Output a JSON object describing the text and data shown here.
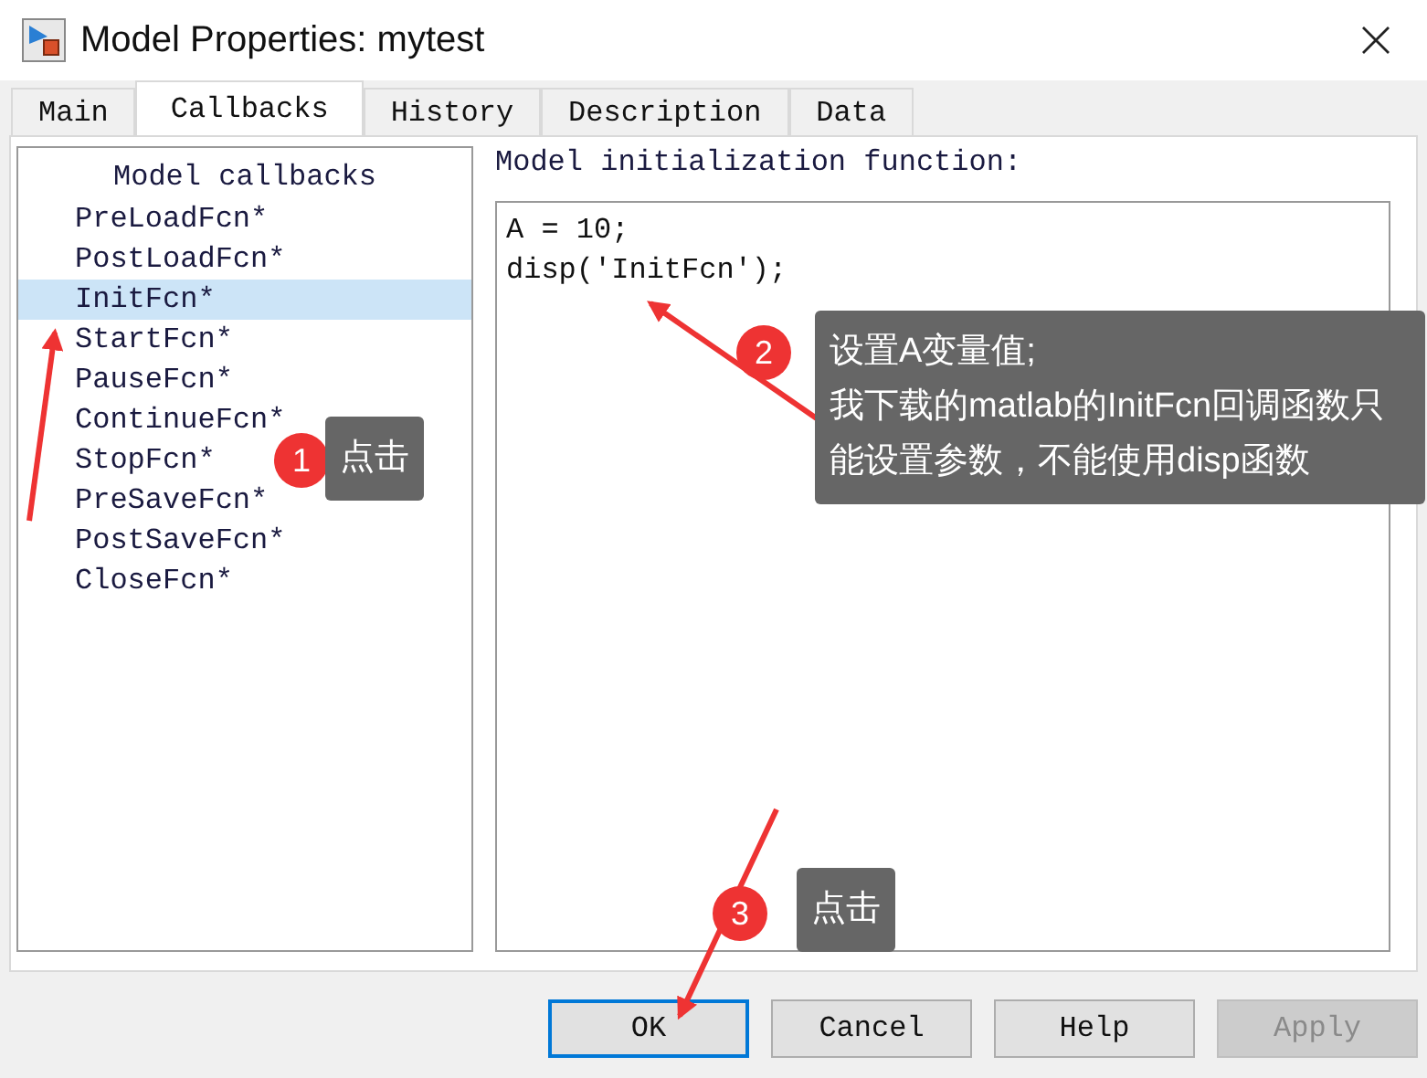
{
  "window": {
    "title": "Model Properties: mytest"
  },
  "tabs": [
    {
      "label": "Main",
      "selected": false
    },
    {
      "label": "Callbacks",
      "selected": true
    },
    {
      "label": "History",
      "selected": false
    },
    {
      "label": "Description",
      "selected": false
    },
    {
      "label": "Data",
      "selected": false
    }
  ],
  "callbacks": {
    "heading": "Model callbacks",
    "items": [
      {
        "label": "PreLoadFcn*",
        "selected": false
      },
      {
        "label": "PostLoadFcn*",
        "selected": false
      },
      {
        "label": "InitFcn*",
        "selected": true
      },
      {
        "label": "StartFcn*",
        "selected": false
      },
      {
        "label": "PauseFcn*",
        "selected": false
      },
      {
        "label": "ContinueFcn*",
        "selected": false
      },
      {
        "label": "StopFcn*",
        "selected": false
      },
      {
        "label": "PreSaveFcn*",
        "selected": false
      },
      {
        "label": "PostSaveFcn*",
        "selected": false
      },
      {
        "label": "CloseFcn*",
        "selected": false
      }
    ]
  },
  "editor": {
    "label": "Model initialization function:",
    "lines": [
      "A = 10;",
      "disp('InitFcn');"
    ]
  },
  "buttons": [
    {
      "label": "OK",
      "focused": true,
      "disabled": false
    },
    {
      "label": "Cancel",
      "focused": false,
      "disabled": false
    },
    {
      "label": "Help",
      "focused": false,
      "disabled": false
    },
    {
      "label": "Apply",
      "focused": false,
      "disabled": true
    }
  ],
  "annotations": [
    {
      "number": "1",
      "text": "点击"
    },
    {
      "number": "2",
      "text": "设置A变量值;\n我下载的matlab的InitFcn回调函数只能设置参数，不能使用disp函数"
    },
    {
      "number": "3",
      "text": "点击"
    }
  ]
}
